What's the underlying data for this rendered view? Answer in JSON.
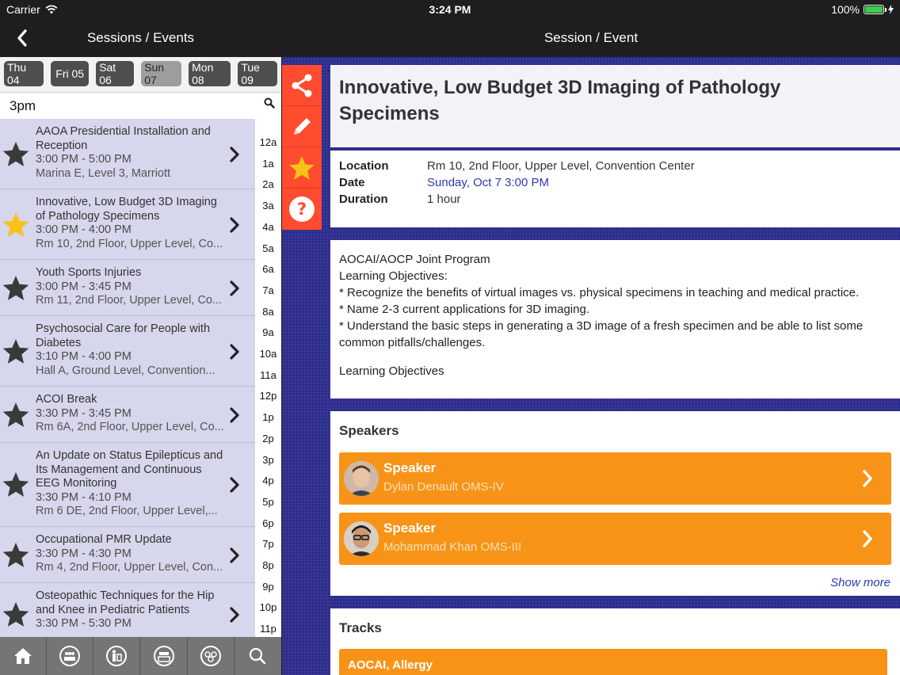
{
  "status_bar": {
    "carrier": "Carrier",
    "time": "3:24 PM",
    "battery": "100%",
    "battery_level": 1.0
  },
  "left_nav": {
    "title": "Sessions / Events",
    "back_icon": "chevron-left-icon"
  },
  "days": [
    {
      "label": "Thu 04",
      "active": false
    },
    {
      "label": "Fri 05",
      "active": false
    },
    {
      "label": "Sat 06",
      "active": false
    },
    {
      "label": "Sun 07",
      "active": true
    },
    {
      "label": "Mon 08",
      "active": false
    },
    {
      "label": "Tue 09",
      "active": false
    }
  ],
  "search": {
    "current_hour": "3pm",
    "icon": "search-icon"
  },
  "sessions": [
    {
      "title": "AAOA Presidential Installation and Reception",
      "time": "3:00 PM - 5:00 PM",
      "location": "Marina E, Level 3, Marriott",
      "starred": false
    },
    {
      "title": "Innovative, Low Budget 3D Imaging of Pathology Specimens",
      "time": "3:00 PM - 4:00 PM",
      "location": "Rm 10, 2nd Floor, Upper Level, Co...",
      "starred": true
    },
    {
      "title": "Youth Sports Injuries",
      "time": "3:00 PM - 3:45 PM",
      "location": "Rm 11, 2nd Floor, Upper Level, Co...",
      "starred": false
    },
    {
      "title": "Psychosocial Care for People with Diabetes",
      "time": "3:10 PM - 4:00 PM",
      "location": "Hall A, Ground Level, Convention...",
      "starred": false
    },
    {
      "title": "ACOI Break",
      "time": "3:30 PM - 3:45 PM",
      "location": "Rm 6A, 2nd Floor, Upper Level, Co...",
      "starred": false
    },
    {
      "title": "An Update on Status Epilepticus and Its Management and Continuous EEG Monitoring",
      "time": "3:30 PM - 4:10 PM",
      "location": "Rm 6 DE, 2nd Floor, Upper Level,...",
      "starred": false
    },
    {
      "title": "Occupational PMR Update",
      "time": "3:30 PM - 4:30 PM",
      "location": "Rm 4, 2nd Floor, Upper Level, Con...",
      "starred": false
    },
    {
      "title": "Osteopathic Techniques for the Hip and Knee in Pediatric Patients",
      "time": "3:30 PM - 5:30 PM",
      "location": "",
      "starred": false
    }
  ],
  "hour_index": [
    "12a",
    "1a",
    "2a",
    "3a",
    "4a",
    "5a",
    "6a",
    "7a",
    "8a",
    "9a",
    "10a",
    "11a",
    "12p",
    "1p",
    "2p",
    "3p",
    "4p",
    "5p",
    "6p",
    "7p",
    "8p",
    "9p",
    "10p",
    "11p"
  ],
  "tab_bar": [
    "home-icon",
    "sessions-icon",
    "speakers-icon",
    "exhibitors-icon",
    "attendees-icon",
    "search-icon"
  ],
  "right_nav": {
    "title": "Session / Event"
  },
  "actions": [
    "share-icon",
    "pencil-icon",
    "star-icon",
    "help-icon"
  ],
  "detail": {
    "title": "Innovative, Low Budget 3D Imaging of Pathology Specimens",
    "location_label": "Location",
    "location": "Rm 10, 2nd Floor, Upper Level, Convention Center",
    "date_label": "Date",
    "date": "Sunday, Oct 7 3:00 PM",
    "duration_label": "Duration",
    "duration": "1 hour",
    "description": [
      "AOCAI/AOCP Joint Program",
      "Learning Objectives:",
      "* Recognize the benefits of virtual images vs. physical specimens in teaching and medical practice.",
      "* Name 2-3 current applications for 3D imaging.",
      "* Understand the basic steps in generating a 3D image of a fresh specimen and be able to list some common pitfalls/challenges.",
      "",
      "Learning Objectives"
    ],
    "speakers_heading": "Speakers",
    "speakers": [
      {
        "role": "Speaker",
        "name": "Dylan Denault OMS-IV"
      },
      {
        "role": "Speaker",
        "name": "Mohammad Khan OMS-III"
      }
    ],
    "show_more": "Show more",
    "tracks_heading": "Tracks",
    "tracks": [
      "AOCAI, Allergy"
    ]
  },
  "colors": {
    "accent_orange": "#f79418",
    "action_red": "#ff4b2e",
    "background_blue": "#2c2c8c",
    "star_gold": "#f7c31b",
    "link_blue": "#2b3ab8"
  }
}
